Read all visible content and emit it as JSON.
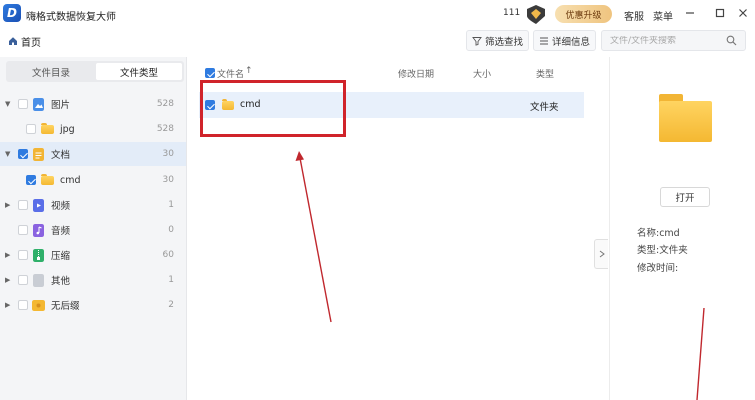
{
  "app": {
    "title": "嗨格式数据恢复大师",
    "counter": "111"
  },
  "titlebar": {
    "promo_label": "优惠升级",
    "support_label": "客服",
    "menu_label": "菜单"
  },
  "toolbar": {
    "home_label": "首页",
    "filter_label": "筛选查找",
    "detail_label": "详细信息",
    "search_placeholder": "文件/文件夹搜索"
  },
  "left": {
    "tabs": [
      {
        "label": "文件目录"
      },
      {
        "label": "文件类型",
        "active": true
      }
    ],
    "tree": [
      {
        "label": "图片",
        "count": "528",
        "expanded": true,
        "checked": false,
        "icon": "image-icon"
      },
      {
        "label": "jpg",
        "count": "528",
        "child": true,
        "checked": false,
        "icon": "folder-icon"
      },
      {
        "label": "文档",
        "count": "30",
        "expanded": true,
        "checked": true,
        "selected": true,
        "icon": "document-icon"
      },
      {
        "label": "cmd",
        "count": "30",
        "child": true,
        "checked": true,
        "icon": "folder-icon"
      },
      {
        "label": "视频",
        "count": "1",
        "checked": false,
        "icon": "video-icon"
      },
      {
        "label": "音频",
        "count": "0",
        "checked": false,
        "icon": "audio-icon"
      },
      {
        "label": "压缩",
        "count": "60",
        "checked": false,
        "icon": "archive-icon"
      },
      {
        "label": "其他",
        "count": "1",
        "checked": false,
        "icon": "other-file-icon"
      },
      {
        "label": "无后缀",
        "count": "2",
        "checked": false,
        "icon": "no-extension-icon"
      }
    ]
  },
  "list": {
    "columns": {
      "name": "文件名",
      "modified": "修改日期",
      "size": "大小",
      "type": "类型"
    },
    "rows": [
      {
        "name": "cmd",
        "type": "文件夹",
        "checked": true
      }
    ]
  },
  "preview": {
    "open_label": "打开",
    "name_line": "名称:cmd",
    "type_line": "类型:文件夹",
    "modified_line": "修改时间:"
  },
  "colors": {
    "accent": "#2f7be0",
    "annotation": "#d0232a",
    "folder": "#f4b832"
  }
}
